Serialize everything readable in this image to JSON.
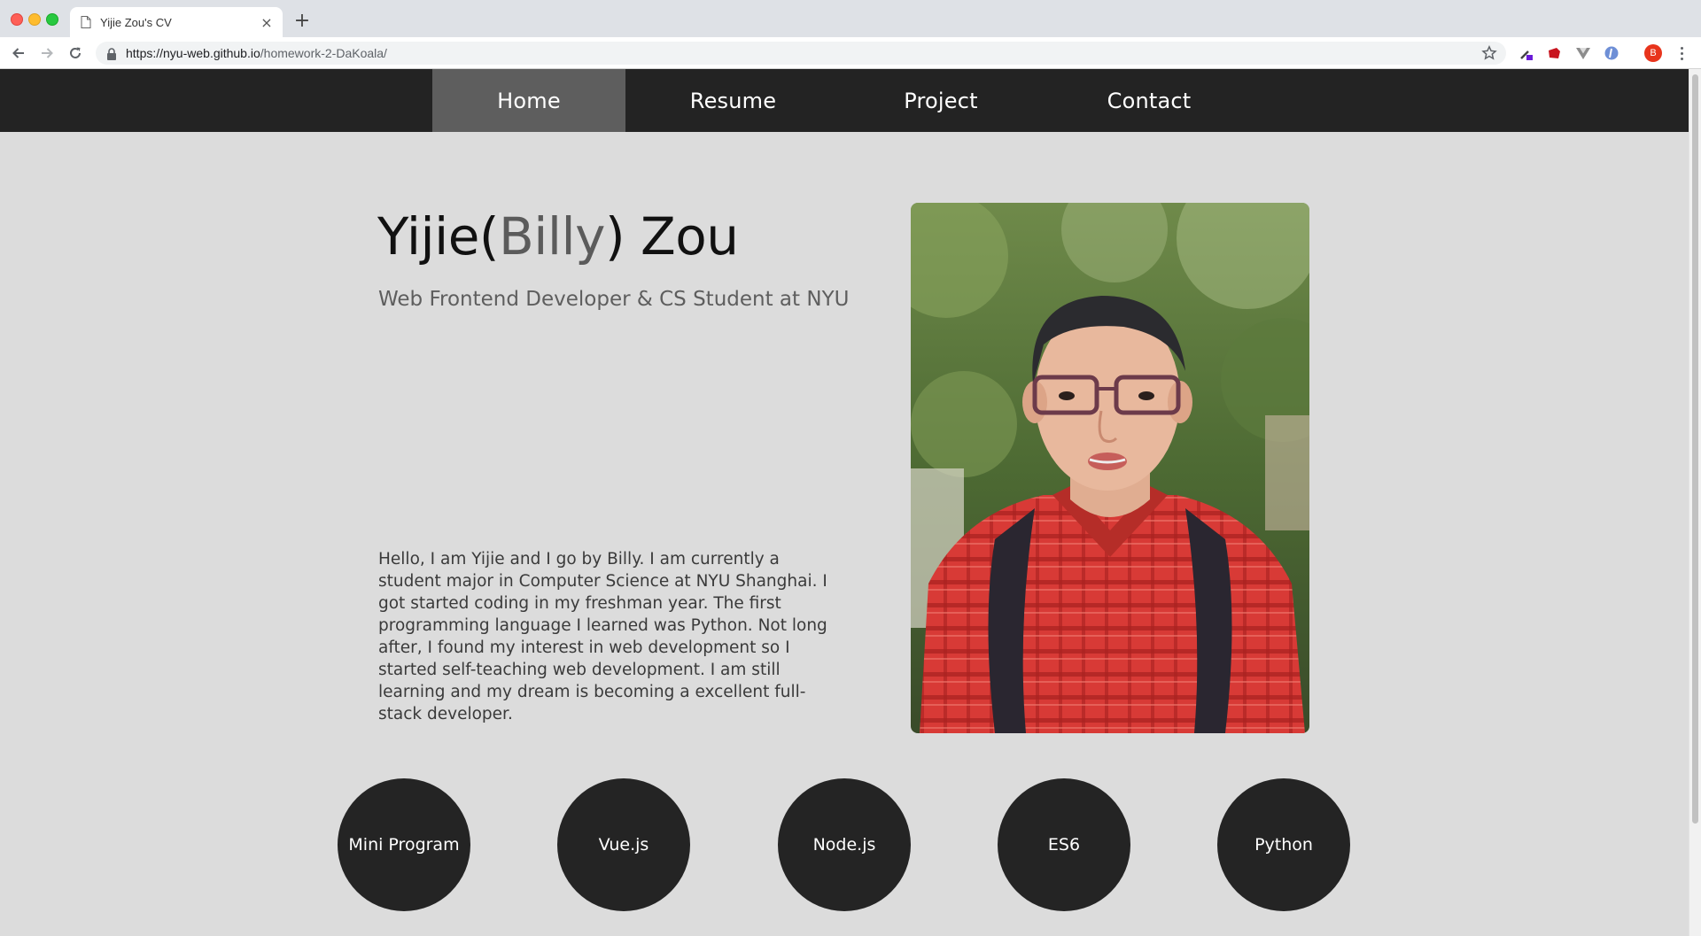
{
  "browser": {
    "tab_title": "Yijie Zou's CV",
    "tab_close": "×",
    "new_tab": "+",
    "url_host": "https://nyu-web.github.io",
    "url_path": "/homework-2-DaKoala/",
    "profile_initial": "B",
    "icons": {
      "back": "back-arrow-icon",
      "forward": "forward-arrow-icon",
      "reload": "reload-icon",
      "lock": "lock-icon",
      "star": "star-icon",
      "menu": "kebab-menu-icon"
    }
  },
  "nav": {
    "items": [
      {
        "label": "Home",
        "active": true
      },
      {
        "label": "Resume",
        "active": false
      },
      {
        "label": "Project",
        "active": false
      },
      {
        "label": "Contact",
        "active": false
      }
    ]
  },
  "hero": {
    "name_first": "Yijie(",
    "name_nick": "Billy",
    "name_last": ") Zou",
    "subtitle": "Web Frontend Developer & CS Student at NYU",
    "bio": "Hello, I am Yijie and I go by Billy. I am currently a student major in Computer Science at NYU Shanghai. I got started coding in my freshman year. The first programming language I learned was Python. Not long after, I found my interest in web development so I started self-teaching web development. I am still learning and my dream is becoming a excellent full-stack developer."
  },
  "skills": [
    {
      "label": "Mini Program"
    },
    {
      "label": "Vue.js"
    },
    {
      "label": "Node.js"
    },
    {
      "label": "ES6"
    },
    {
      "label": "Python"
    }
  ],
  "colors": {
    "nav_bg": "#232323",
    "nav_active": "#5e5e5e",
    "page_bg": "#dcdcdc",
    "skill_bg": "#242424"
  }
}
